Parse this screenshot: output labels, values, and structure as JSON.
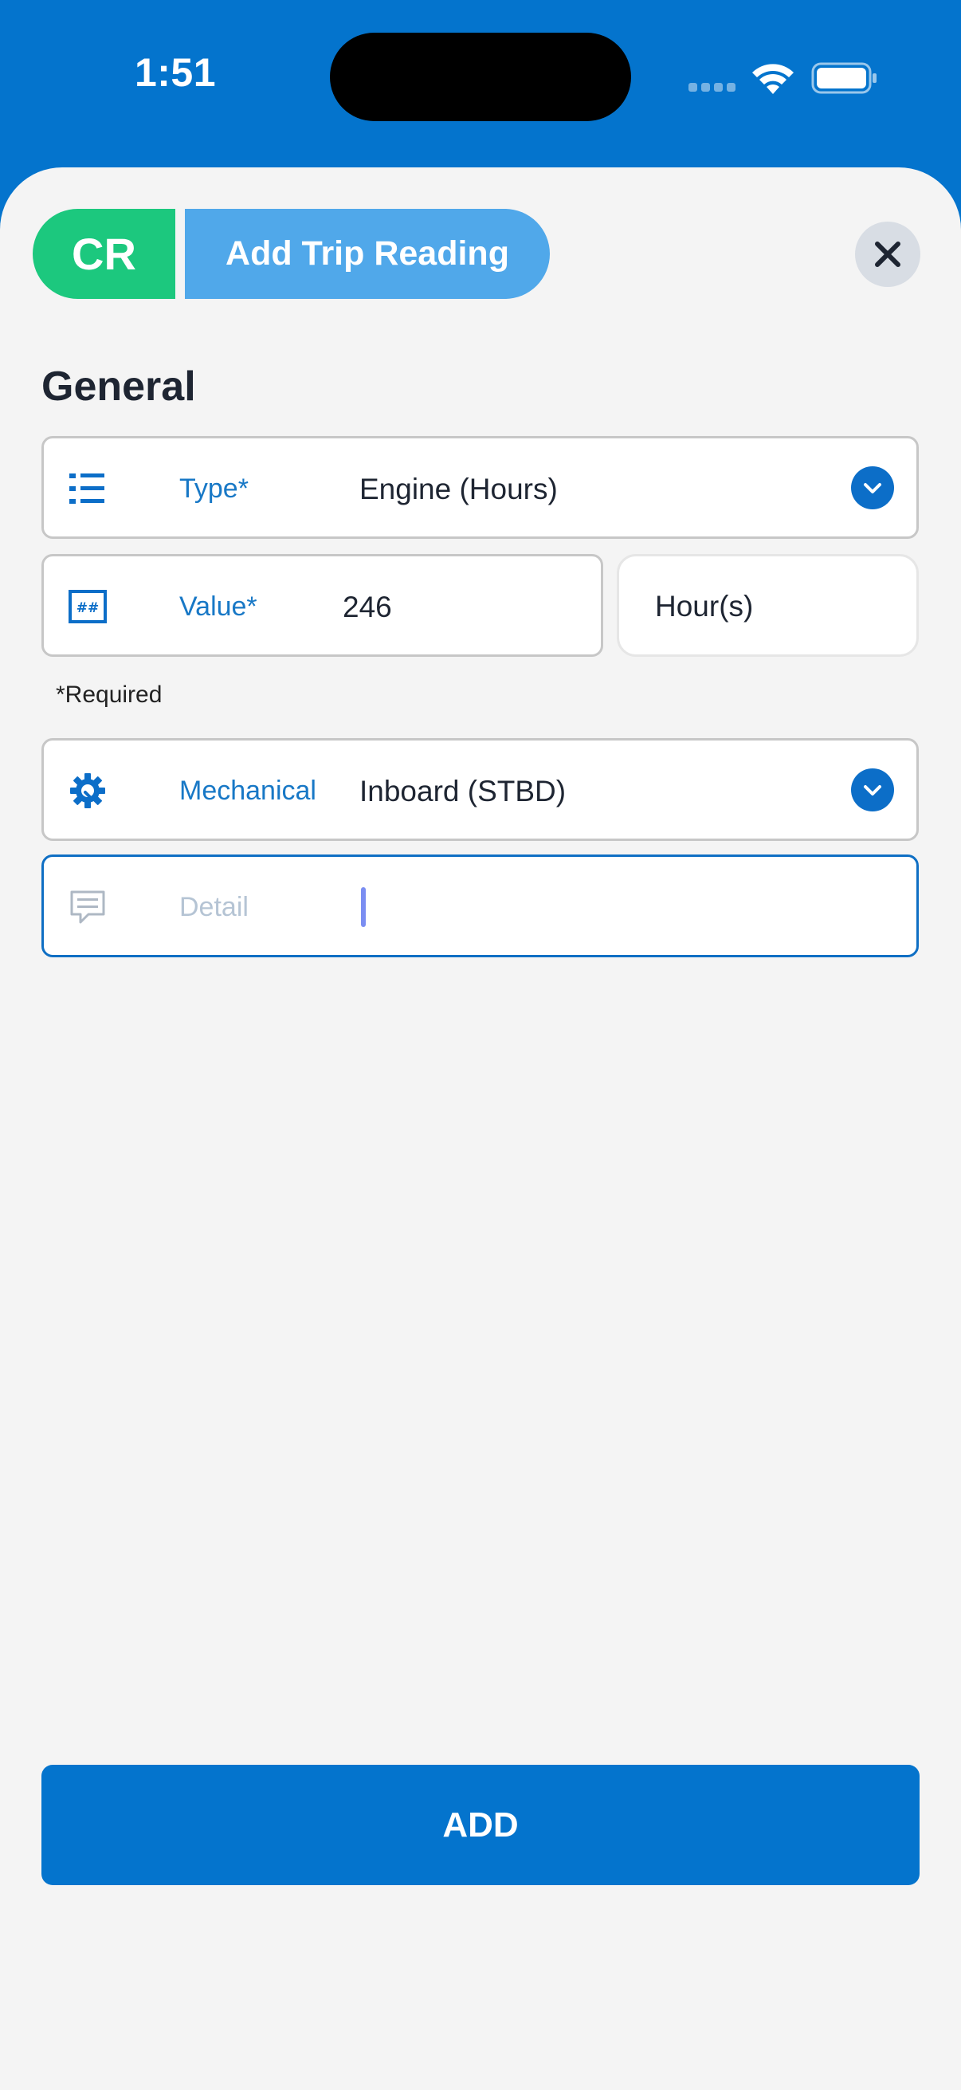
{
  "status_bar": {
    "time": "1:51"
  },
  "header": {
    "badge": "CR",
    "title": "Add Trip Reading"
  },
  "section": {
    "title": "General"
  },
  "fields": {
    "type": {
      "label": "Type*",
      "value": "Engine (Hours)",
      "icon": "list-icon"
    },
    "value": {
      "label": "Value*",
      "value": "246",
      "icon": "number-icon",
      "unit": "Hour(s)"
    },
    "required_note": "*Required",
    "mechanical": {
      "label": "Mechanical",
      "value": "Inboard (STBD)",
      "icon": "gear-icon"
    },
    "detail": {
      "placeholder": "Detail",
      "value": "",
      "icon": "comment-icon"
    }
  },
  "actions": {
    "add_label": "ADD"
  },
  "colors": {
    "primary": "#0474cd",
    "badge_green": "#1cc87e",
    "title_chip": "#50a8ea",
    "label_blue": "#1878c6",
    "background": "#f4f4f4"
  }
}
